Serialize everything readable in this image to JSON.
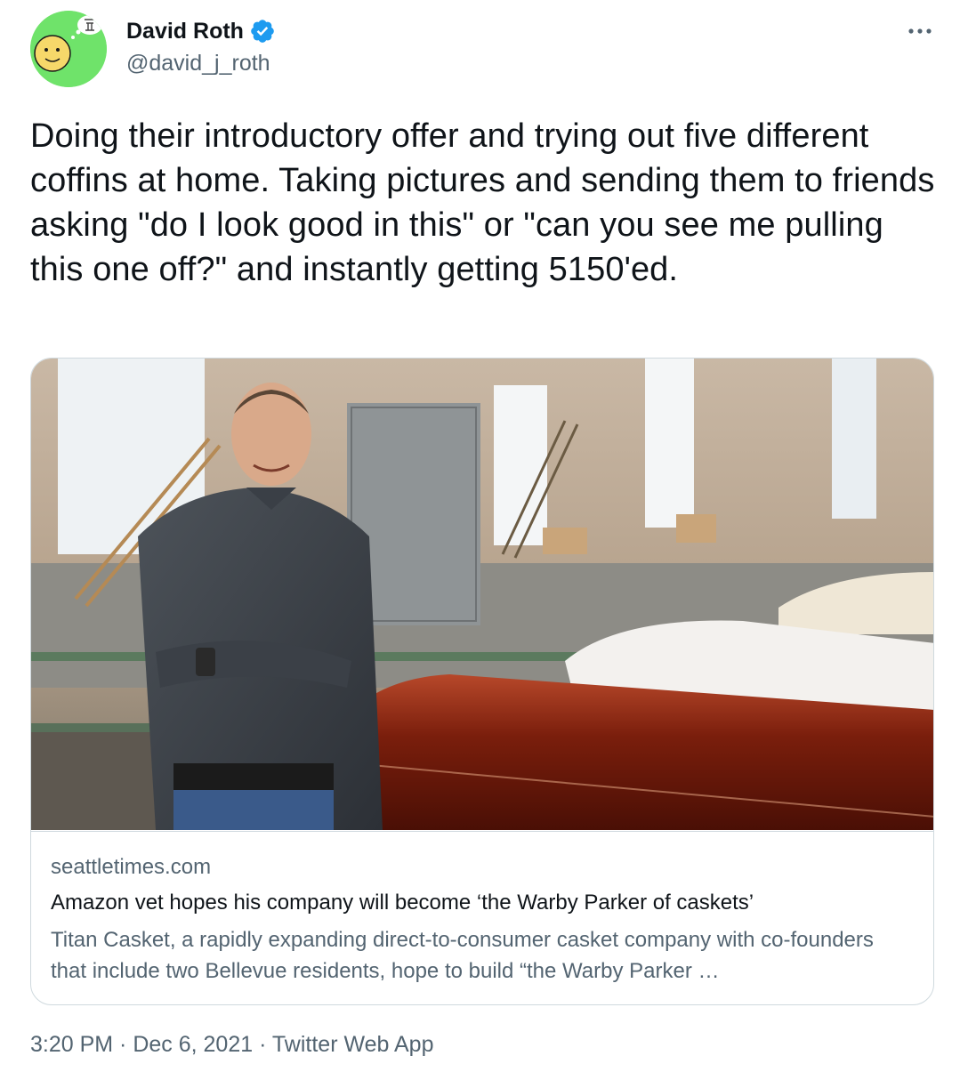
{
  "tweet": {
    "author_name": "David Roth",
    "author_handle": "@david_j_roth",
    "body": "Doing their introductory offer and trying out five different coffins at home. Taking pictures and sending them to friends asking \"do I look good in this\" or \"can you see me pulling this one off?\" and instantly getting 5150'ed.",
    "meta": "3:20 PM · Dec 6, 2021 · Twitter Web App"
  },
  "card": {
    "domain": "seattletimes.com",
    "title": "Amazon vet hopes his company will become ‘the Warby Parker of caskets’",
    "description": "Titan Casket, a rapidly expanding direct-to-consumer casket company with co-founders that include two Bellevue residents, hope to build “the Warby Parker …"
  },
  "icons": {
    "verified": "verified-badge-icon",
    "more": "more-options-icon"
  },
  "colors": {
    "verified_blue": "#1d9bf0",
    "secondary_text": "#536471",
    "avatar_green": "#6fe36a",
    "casket_wood": "#7a1e0c"
  }
}
